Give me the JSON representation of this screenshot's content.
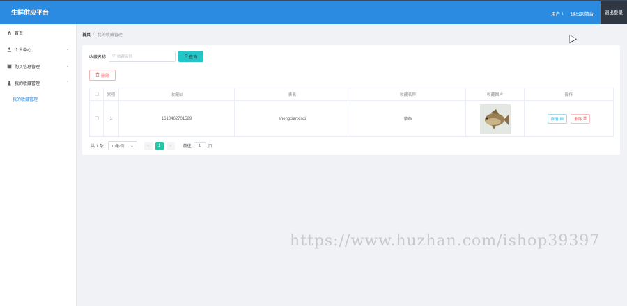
{
  "header": {
    "title": "生鲜供应平台",
    "user": "用户 1",
    "back_to_front": "退出到前台",
    "logout": "退出登录"
  },
  "sidebar": {
    "items": [
      {
        "label": "首页",
        "icon": "home-icon"
      },
      {
        "label": "个人中心",
        "icon": "user-icon"
      },
      {
        "label": "购买信息管理",
        "icon": "store-icon"
      },
      {
        "label": "我的收藏管理",
        "icon": "person-icon"
      }
    ],
    "submenu": [
      {
        "label": "我的收藏管理"
      }
    ]
  },
  "breadcrumb": {
    "home": "首页",
    "separator": "/",
    "current": "我的收藏管理"
  },
  "search": {
    "label": "收藏名称",
    "placeholder": "收藏名称",
    "button": "查询"
  },
  "toolbar": {
    "delete_label": "删除"
  },
  "table": {
    "columns": [
      "",
      "索引",
      "收藏id",
      "表名",
      "收藏名称",
      "收藏图片",
      "操作"
    ],
    "rows": [
      {
        "index": "1",
        "id": "1610462701529",
        "table_name": "shengxianxinxi",
        "name": "草鱼",
        "detail_label": "详情",
        "delete_label": "删除"
      }
    ]
  },
  "pagination": {
    "total": "共 1 条",
    "page_size": "10条/页",
    "current_page": "1",
    "goto_label": "前往",
    "goto_value": "1",
    "page_unit": "页"
  },
  "watermark": "https://www.huzhan.com/ishop39397",
  "colors": {
    "header": "#2b8be0",
    "accent": "#23c6c8",
    "danger": "#f56c6c"
  }
}
